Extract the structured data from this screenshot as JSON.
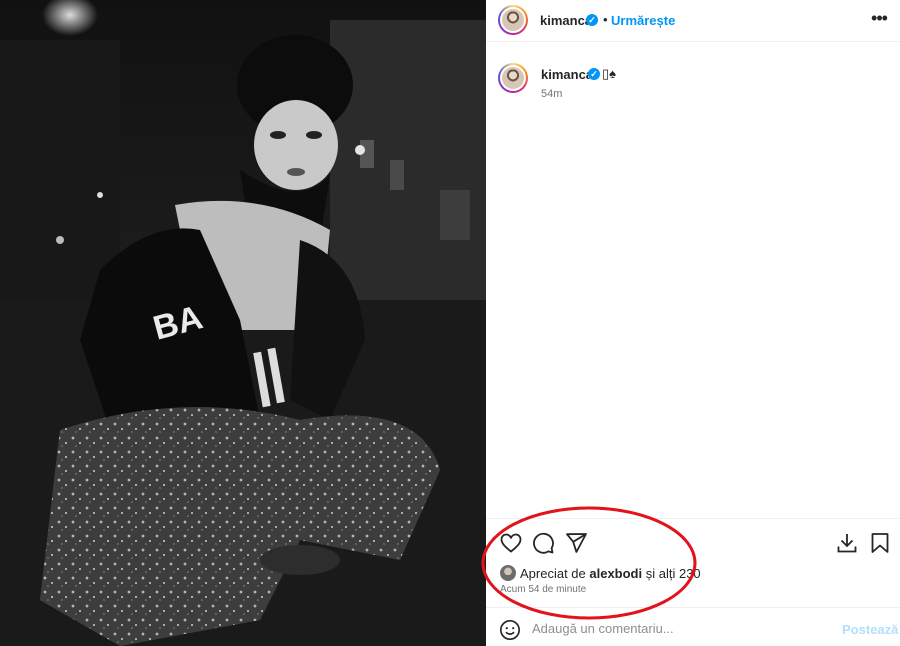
{
  "post": {
    "photo_description_icon": "photo-icon"
  },
  "header": {
    "username": "kimanca",
    "dot": "•",
    "follow_label": "Urmărește",
    "more_label": "•••"
  },
  "caption": {
    "username": "kimanca",
    "text": "▯♠",
    "time": "54m"
  },
  "likes": {
    "prefix": "Apreciat de ",
    "user": "alexbodi",
    "suffix": " și alți 230"
  },
  "timestamp": "Acum 54 de minute",
  "comment": {
    "placeholder": "Adaugă un comentariu...",
    "post_label": "Postează"
  },
  "colors": {
    "accent": "#0095f6",
    "annotation": "#e3131b"
  }
}
